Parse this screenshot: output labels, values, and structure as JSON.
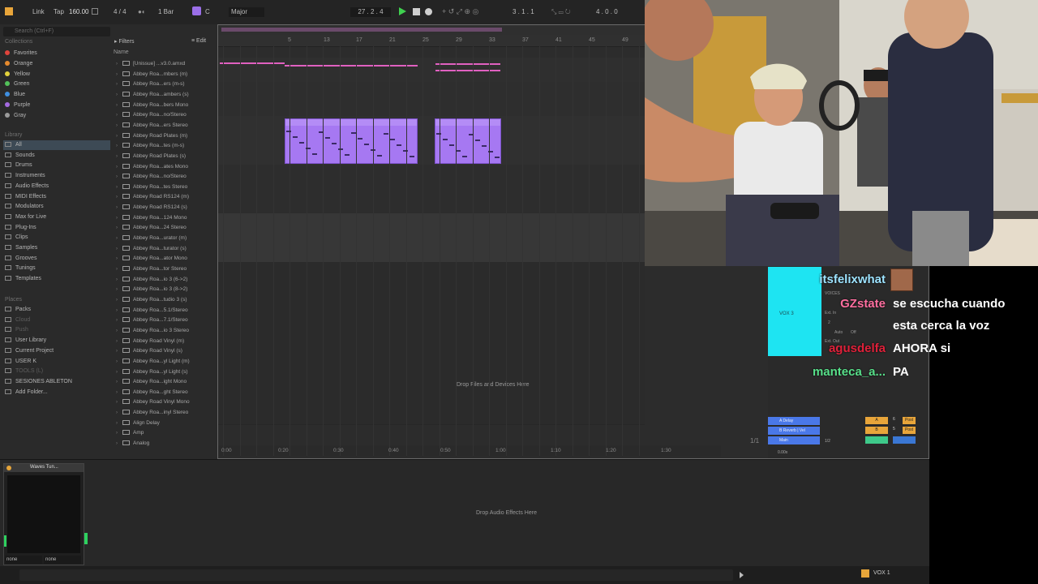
{
  "transport": {
    "link": "Link",
    "tap": "Tap",
    "tempo": "160.00",
    "time_sig": "4 / 4",
    "quantize": "1 Bar",
    "key": "C",
    "scale": "Major",
    "position": "27 .   2 .   4",
    "loop_start": "3 .   1 .   1",
    "loop_length": "4 .   0 .   0"
  },
  "browser": {
    "search_placeholder": "Search (Ctrl+F)",
    "collections_header": "Collections",
    "collections": [
      {
        "label": "Favorites",
        "color": "#e0443c"
      },
      {
        "label": "Orange",
        "color": "#e68a2e"
      },
      {
        "label": "Yellow",
        "color": "#e3d23c"
      },
      {
        "label": "Green",
        "color": "#52c15a"
      },
      {
        "label": "Blue",
        "color": "#3f8fe0"
      },
      {
        "label": "Purple",
        "color": "#a46ae0"
      },
      {
        "label": "Gray",
        "color": "#9a9a9a"
      }
    ],
    "library_header": "Library",
    "library": [
      "All",
      "Sounds",
      "Drums",
      "Instruments",
      "Audio Effects",
      "MIDI Effects",
      "Modulators",
      "Max for Live",
      "Plug-Ins",
      "Clips",
      "Samples",
      "Grooves",
      "Tunings",
      "Templates"
    ],
    "places_header": "Places",
    "places": [
      "Packs",
      "Cloud",
      "Push",
      "User Library",
      "Current Project",
      "USER K",
      "TOOLS (L)",
      "SESIONES ABLETON",
      "Add Folder..."
    ],
    "filters_label": "Filters",
    "edit_label": "Edit",
    "name_column": "Name",
    "files": [
      "[Unissue] ...v3.0.amxd",
      "Abbey Roa...mbers (m)",
      "Abbey Roa...ers (m-s)",
      "Abbey Roa...ambers (s)",
      "Abbey Roa...bers Mono",
      "Abbey Roa...no/Stereo",
      "Abbey Roa...ers Stereo",
      "Abbey Road Plates (m)",
      "Abbey Roa...tes (m-s)",
      "Abbey Road Plates (s)",
      "Abbey Roa...ates Mono",
      "Abbey Roa...no/Stereo",
      "Abbey Roa...tes Stereo",
      "Abbey Road RS124 (m)",
      "Abbey Road RS124 (s)",
      "Abbey Roa...124 Mono",
      "Abbey Roa...24 Stereo",
      "Abbey Roa...urator (m)",
      "Abbey Roa...turator (s)",
      "Abbey Roa...ator Mono",
      "Abbey Roa...tor Stereo",
      "Abbey Roa...io 3 (6->2)",
      "Abbey Roa...io 3 (8->2)",
      "Abbey Roa...tudio 3 (s)",
      "Abbey Roa...5.1/Stereo",
      "Abbey Roa...7.1/Stereo",
      "Abbey Roa...io 3 Stereo",
      "Abbey Road Vinyl (m)",
      "Abbey Road Vinyl (s)",
      "Abbey Roa...yl Light (m)",
      "Abbey Roa...yl Light (s)",
      "Abbey Roa...ight Mono",
      "Abbey Roa...ght Stereo",
      "Abbey Road Vinyl Mono",
      "Abbey Roa...inyl Stereo",
      "Align Delay",
      "Amp",
      "Analog"
    ]
  },
  "arrangement": {
    "bar_numbers": [
      "5",
      "13",
      "17",
      "21",
      "25",
      "29",
      "33",
      "37",
      "41",
      "45",
      "49"
    ],
    "time_labels": [
      "0:00",
      "0:20",
      "0:30",
      "0:40",
      "0:50",
      "1:00",
      "1:10",
      "1:20",
      "1:30"
    ],
    "time_marker": "0:40",
    "drop_files": "Drop Files and Devices Here",
    "track_name": "VOX 3",
    "mixer_labels": {
      "voices": "VOICES",
      "ext_in": "Ext. In",
      "auto": "Auto",
      "off": "Off",
      "ext_out": "Ext. Out",
      "value_2": "2"
    },
    "returns": [
      {
        "label": "A Delay",
        "letter": "A",
        "num": "6",
        "post": "Post"
      },
      {
        "label": "B Reverb | Vel",
        "letter": "B",
        "num": "5",
        "post": "Post"
      },
      {
        "label": "Main",
        "letter": "",
        "num": "",
        "post": ""
      }
    ],
    "page_indicator": "1/1",
    "main_ratio": "1/2",
    "zoom": "0.00x"
  },
  "chat": [
    {
      "user": "itsfelixwhat",
      "message": "",
      "color": "#9de3ff"
    },
    {
      "user": "GZstate",
      "message": "se escucha cuando",
      "message2": "esta cerca la voz",
      "color": "#ff6fa0"
    },
    {
      "user": "agusdelfa",
      "message": "AHORA si",
      "color": "#e0213a"
    },
    {
      "user": "manteca_a...",
      "message": "PA",
      "color": "#58e08a"
    }
  ],
  "devices": {
    "device_title": "Waves Tun...",
    "drop_audio": "Drop Audio Effects Here",
    "none_1": "none",
    "none_2": "none"
  },
  "statusbar": {
    "track": "VOX 1"
  }
}
